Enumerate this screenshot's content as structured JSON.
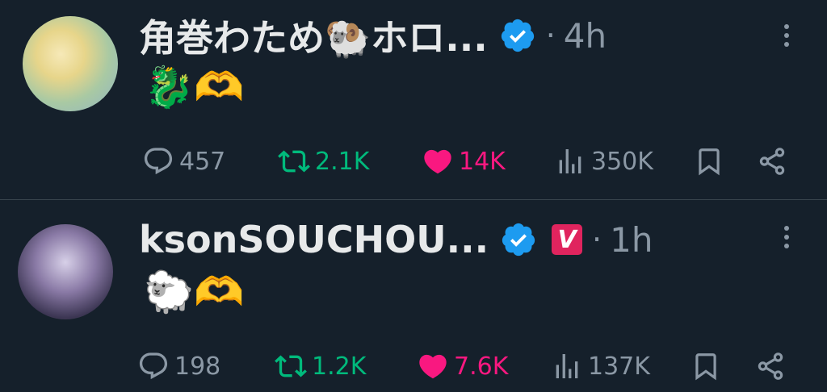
{
  "posts": [
    {
      "display_name": "角巻わため🐏ホロ...",
      "verified": true,
      "dot": "·",
      "time": "4h",
      "text": "🐉🫶",
      "stats": {
        "replies": "457",
        "reposts": "2.1K",
        "likes": "14K",
        "views": "350K"
      }
    },
    {
      "display_name": "ksonSOUCHOU...",
      "verified": true,
      "badge_letter": "V",
      "dot": "·",
      "time": "1h",
      "text": "🐑🫶",
      "stats": {
        "replies": "198",
        "reposts": "1.2K",
        "likes": "7.6K",
        "views": "137K"
      }
    }
  ],
  "colors": {
    "background": "#15202b",
    "text": "#e7e9ea",
    "muted": "#8b98a5",
    "verified": "#1d9bf0",
    "repost": "#00ba7c",
    "like": "#f91880",
    "badge": "#e0245e",
    "divider": "#38444d"
  },
  "icons": [
    "avatar",
    "verified-badge-icon",
    "more-dots-icon",
    "reply-icon",
    "repost-icon",
    "like-heart-icon",
    "views-icon",
    "bookmark-icon",
    "share-icon"
  ]
}
